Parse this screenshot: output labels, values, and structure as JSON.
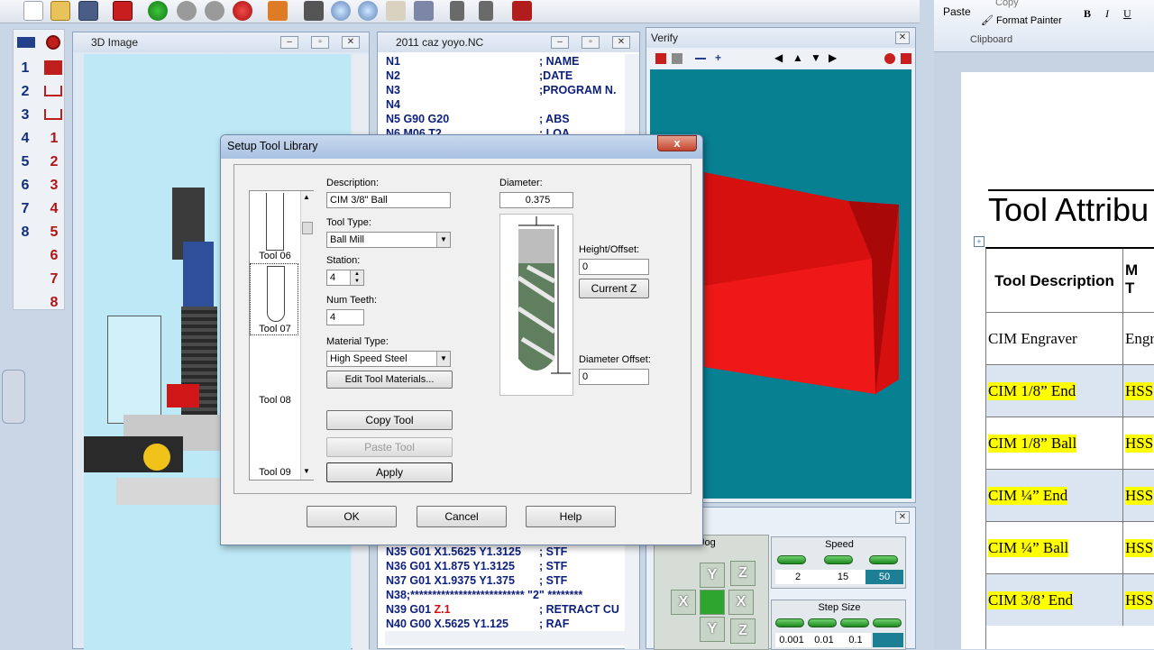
{
  "left_tools": {
    "numbers_left": [
      "1",
      "2",
      "3",
      "4",
      "5",
      "6",
      "7",
      "8"
    ],
    "numbers_right": [
      "1",
      "2",
      "3",
      "4",
      "5",
      "6",
      "7",
      "8"
    ]
  },
  "image_window": {
    "title": "3D Image"
  },
  "nc_window": {
    "title": "2011 caz yoyo.NC",
    "top_lines": [
      {
        "code": "N1",
        "comment": "; NAME"
      },
      {
        "code": "N2",
        "comment": ";DATE"
      },
      {
        "code": "N3",
        "comment": ";PROGRAM N."
      },
      {
        "code": "N4",
        "comment": ""
      },
      {
        "code": "N5 G90 G20",
        "comment": "; ABS"
      },
      {
        "code": "N6 M06 T2",
        "comment": "; LOA"
      }
    ],
    "bottom_lines": [
      {
        "code": "N35 G01 X1.5625 Y1.3125",
        "comment": "; STF"
      },
      {
        "code": "N36 G01 X1.875 Y1.3125",
        "comment": "; STF"
      },
      {
        "code": "N37 G01 X1.9375 Y1.375",
        "comment": "; STF"
      },
      {
        "code": "N38;************************** \"2\" ********",
        "comment": ""
      },
      {
        "code": "N39 G01 Z.1",
        "comment": "; RETRACT CU"
      },
      {
        "code": "N40 G00 X.5625 Y1.125",
        "comment": "; RAF"
      }
    ]
  },
  "verify_window": {
    "title": "Verify"
  },
  "jog_panel": {
    "jog_label": "Jog",
    "speed_label": "Speed",
    "speed_values": [
      "2",
      "15",
      "50"
    ],
    "step_label": "Step Size",
    "step_values": [
      "0.001",
      "0.01",
      "0.1"
    ],
    "axis_labels": {
      "y": "Y",
      "z": "Z",
      "x": "X",
      "xm": "X",
      "ym": "Y",
      "zm": "Z"
    }
  },
  "dialog": {
    "title": "Setup Tool Library",
    "close": "x",
    "tools": [
      "Tool 06",
      "Tool 07",
      "Tool 08",
      "Tool 09"
    ],
    "description_label": "Description:",
    "description_value": "CIM 3/8\" Ball",
    "tool_type_label": "Tool Type:",
    "tool_type_value": "Ball Mill",
    "station_label": "Station:",
    "station_value": "4",
    "num_teeth_label": "Num Teeth:",
    "num_teeth_value": "4",
    "material_label": "Material Type:",
    "material_value": "High Speed Steel",
    "edit_materials": "Edit Tool Materials...",
    "copy_tool": "Copy Tool",
    "paste_tool": "Paste Tool",
    "apply": "Apply",
    "diameter_label": "Diameter:",
    "diameter_value": "0.375",
    "height_offset_label": "Height/Offset:",
    "height_offset_value": "0",
    "current_z": "Current Z",
    "diameter_offset_label": "Diameter Offset:",
    "diameter_offset_value": "0",
    "ok": "OK",
    "cancel": "Cancel",
    "help": "Help"
  },
  "ribbon": {
    "paste": "Paste",
    "copy": "Copy",
    "format_painter": "Format Painter",
    "clipboard": "Clipboard",
    "bold": "B",
    "italic": "I",
    "underline": "U"
  },
  "document": {
    "heading": "Tool  Attribu",
    "col1_header": "Tool Description",
    "col2_header": "M\nT",
    "rows": [
      {
        "desc": "CIM Engraver",
        "mat": "Engr",
        "highlight": false
      },
      {
        "desc": "CIM 1/8” End",
        "mat": "HSS",
        "highlight": true
      },
      {
        "desc": "CIM 1/8” Ball",
        "mat": "HSS",
        "highlight": true
      },
      {
        "desc": "CIM ¼” End",
        "mat": "HSS",
        "highlight": true
      },
      {
        "desc": "CIM ¼” Ball",
        "mat": "HSS",
        "highlight": true
      },
      {
        "desc": "CIM 3/8’ End",
        "mat": "HSS",
        "highlight": true
      }
    ]
  }
}
